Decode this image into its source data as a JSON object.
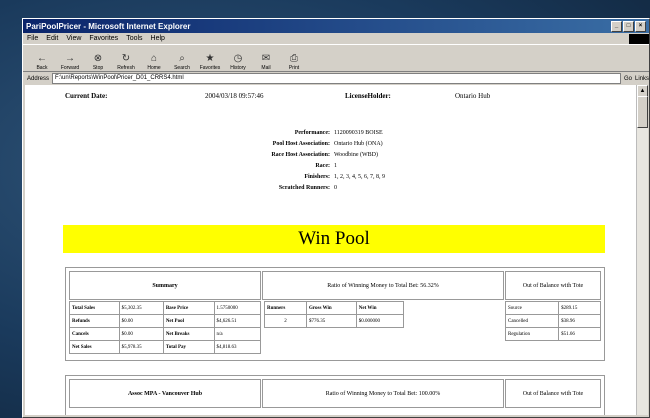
{
  "window": {
    "title": "PariPoolPricer - Microsoft Internet Explorer",
    "menu": [
      "File",
      "Edit",
      "View",
      "Favorites",
      "Tools",
      "Help"
    ],
    "toolbar": [
      "Back",
      "Forward",
      "Stop",
      "Refresh",
      "Home",
      "Search",
      "Favorites",
      "History",
      "Mail",
      "Print"
    ],
    "address_label": "Address",
    "address_value": "F:\\un\\Reports\\WinPool\\Pricer_D01_CRRS4.html",
    "go_label": "Go",
    "links_label": "Links"
  },
  "report": {
    "current_date_label": "Current Date:",
    "current_date_value": "2004/03/18 09:57:46",
    "license_holder_label": "LicenseHolder:",
    "license_holder_value": "Ontario Hub",
    "info": [
      {
        "label": "Performance:",
        "value": "1120090319 BOISE"
      },
      {
        "label": "Pool Host Association:",
        "value": "Ontario Hub (ONA)"
      },
      {
        "label": "Race Host Association:",
        "value": "Woodbine (WBD)"
      },
      {
        "label": "Race:",
        "value": "1"
      },
      {
        "label": "Finishers:",
        "value": "1, 2, 3, 4, 5, 6, 7, 8, 9"
      },
      {
        "label": "Scratched Runners:",
        "value": "0"
      }
    ],
    "banner": "Win Pool",
    "panel1": {
      "summary_title": "Summary",
      "ratio_text": "Ratio of Winning Money to Total Bet: 56.32%",
      "oob_title": "Out of Balance with Tote",
      "summary_rows": [
        [
          "Total Sales",
          "$5,302.35",
          "Base Price",
          "1.5750000"
        ],
        [
          "Refunds",
          "$0.00",
          "Net Pool",
          "$4,626.51"
        ],
        [
          "Cancels",
          "$0.00",
          "Net Breaks",
          "n/a"
        ],
        [
          "Net Sales",
          "$5,978.35",
          "Total Pay",
          "$4,818.63"
        ]
      ],
      "winner_headers": [
        "Runners",
        "Gross Win",
        "Net Win"
      ],
      "winner_rows": [
        [
          "2",
          "$776.35",
          "$0.000000"
        ]
      ],
      "oob_rows": [
        [
          "Source",
          "$289.15"
        ],
        [
          "Cancelled",
          "$38.96"
        ],
        [
          "Regulation",
          "$51.66"
        ]
      ]
    },
    "panel2": {
      "title": "Assoc MPA - Vancouver Hub",
      "ratio_text": "Ratio of Winning Money to Total Bet: 100.00%",
      "oob_title": "Out of Balance with Tote"
    }
  }
}
